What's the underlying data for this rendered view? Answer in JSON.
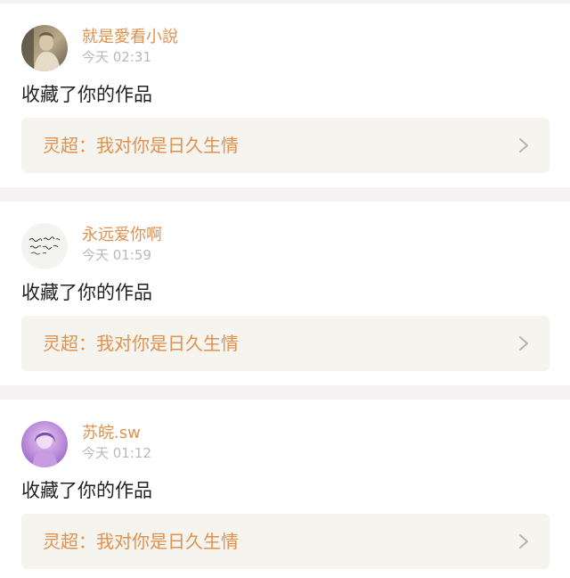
{
  "theme": {
    "accent": "#e0914f",
    "background": "#f4f2f2",
    "card_background": "#ffffff",
    "link_background": "#f5f4ee",
    "muted_text": "#b9b9b9"
  },
  "notifications": [
    {
      "avatar_icon": "portrait-avatar",
      "username": "就是愛看小說",
      "time": "今天 02:31",
      "action": "收藏了你的作品",
      "work_title": "灵超：我对你是日久生情"
    },
    {
      "avatar_icon": "handwriting-avatar",
      "username": "永远爱你啊",
      "time": "今天 01:59",
      "action": "收藏了你的作品",
      "work_title": "灵超：我对你是日久生情"
    },
    {
      "avatar_icon": "purple-portrait-avatar",
      "username": "苏皖.sw",
      "time": "今天 01:12",
      "action": "收藏了你的作品",
      "work_title": "灵超：我对你是日久生情"
    }
  ]
}
